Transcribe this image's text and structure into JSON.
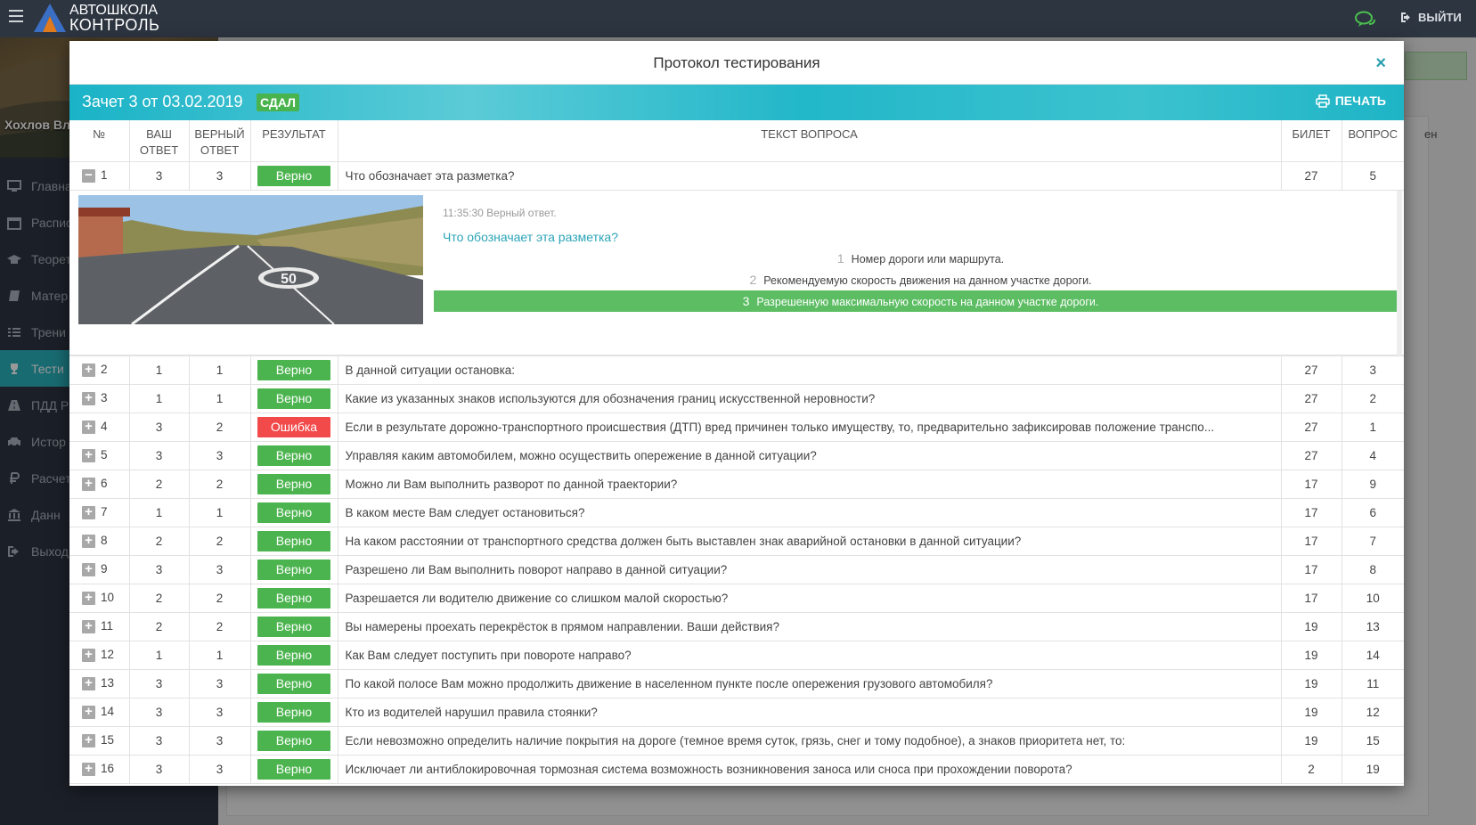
{
  "topbar": {
    "logo_line1": "АВТОШКОЛА",
    "logo_line2": "КОНТРОЛЬ",
    "logout_label": "ВЫЙТИ",
    "icons": [
      "menu-icon",
      "chat-icon",
      "logout-icon"
    ]
  },
  "sidebar": {
    "user_name": "Хохлов Вл",
    "items": [
      {
        "label": "Главна",
        "icon": "monitor-icon"
      },
      {
        "label": "Распис",
        "icon": "calendar-icon"
      },
      {
        "label": "Теорет",
        "icon": "graduation-cap-icon"
      },
      {
        "label": "Матер",
        "icon": "book-icon"
      },
      {
        "label": "Трени",
        "icon": "list-icon"
      },
      {
        "label": "Тести",
        "icon": "trophy-icon",
        "active": true
      },
      {
        "label": "ПДД Р",
        "icon": "road-icon"
      },
      {
        "label": "Истор",
        "icon": "car-icon"
      },
      {
        "label": "Расчет",
        "icon": "ruble-icon"
      },
      {
        "label": "Данн",
        "icon": "bank-icon"
      },
      {
        "label": "Выход",
        "icon": "sign-out-icon"
      }
    ]
  },
  "background": {
    "side_text": "ен"
  },
  "modal": {
    "title": "Протокол тестирования",
    "close_symbol": "×",
    "exam_title": "Зачет 3 от 03.02.2019",
    "status_badge": "СДАЛ",
    "print_label": "ПЕЧАТЬ",
    "columns": {
      "num": "№",
      "your_1": "ВАШ",
      "your_2": "ОТВЕТ",
      "correct_1": "ВЕРНЫЙ",
      "correct_2": "ОТВЕТ",
      "result": "РЕЗУЛЬТАТ",
      "text": "ТЕКСТ ВОПРОСА",
      "ticket": "БИЛЕТ",
      "question": "ВОПРОС"
    },
    "expanded": {
      "time_note": "11:35:30 Верный ответ.",
      "question": "Что обозначает эта разметка?",
      "image_speed_mark": "50",
      "selected_index": 3,
      "options": [
        {
          "n": "1",
          "text": "Номер дороги или маршрута."
        },
        {
          "n": "2",
          "text": "Рекомендуемую скорость движения на данном участке дороги."
        },
        {
          "n": "3",
          "text": "Разрешенную максимальную скорость на данном участке дороги."
        }
      ]
    },
    "rows": [
      {
        "num": "1",
        "toggle": "−",
        "your": "3",
        "correct": "3",
        "result": "Верно",
        "ok": true,
        "text": "Что обозначает эта разметка?",
        "ticket": "27",
        "question": "5"
      },
      {
        "num": "2",
        "toggle": "+",
        "your": "1",
        "correct": "1",
        "result": "Верно",
        "ok": true,
        "text": "В данной ситуации остановка:",
        "ticket": "27",
        "question": "3"
      },
      {
        "num": "3",
        "toggle": "+",
        "your": "1",
        "correct": "1",
        "result": "Верно",
        "ok": true,
        "text": "Какие из указанных знаков используются для обозначения границ искусственной неровности?",
        "ticket": "27",
        "question": "2"
      },
      {
        "num": "4",
        "toggle": "+",
        "your": "3",
        "correct": "2",
        "result": "Ошибка",
        "ok": false,
        "text": "Если в результате дорожно-транспортного происшествия (ДТП) вред причинен только имуществу, то, предварительно зафиксировав положение транспо...",
        "ticket": "27",
        "question": "1"
      },
      {
        "num": "5",
        "toggle": "+",
        "your": "3",
        "correct": "3",
        "result": "Верно",
        "ok": true,
        "text": "Управляя каким автомобилем, можно осуществить опережение в данной ситуации?",
        "ticket": "27",
        "question": "4"
      },
      {
        "num": "6",
        "toggle": "+",
        "your": "2",
        "correct": "2",
        "result": "Верно",
        "ok": true,
        "text": "Можно ли Вам выполнить разворот по данной траектории?",
        "ticket": "17",
        "question": "9"
      },
      {
        "num": "7",
        "toggle": "+",
        "your": "1",
        "correct": "1",
        "result": "Верно",
        "ok": true,
        "text": "В каком месте Вам следует остановиться?",
        "ticket": "17",
        "question": "6"
      },
      {
        "num": "8",
        "toggle": "+",
        "your": "2",
        "correct": "2",
        "result": "Верно",
        "ok": true,
        "text": "На каком расстоянии от транспортного средства должен быть выставлен знак аварийной остановки в данной ситуации?",
        "ticket": "17",
        "question": "7"
      },
      {
        "num": "9",
        "toggle": "+",
        "your": "3",
        "correct": "3",
        "result": "Верно",
        "ok": true,
        "text": "Разрешено ли Вам выполнить поворот направо в данной ситуации?",
        "ticket": "17",
        "question": "8"
      },
      {
        "num": "10",
        "toggle": "+",
        "your": "2",
        "correct": "2",
        "result": "Верно",
        "ok": true,
        "text": "Разрешается ли водителю движение со слишком малой скоростью?",
        "ticket": "17",
        "question": "10"
      },
      {
        "num": "11",
        "toggle": "+",
        "your": "2",
        "correct": "2",
        "result": "Верно",
        "ok": true,
        "text": "Вы намерены проехать перекрёсток в прямом направлении. Ваши действия?",
        "ticket": "19",
        "question": "13"
      },
      {
        "num": "12",
        "toggle": "+",
        "your": "1",
        "correct": "1",
        "result": "Верно",
        "ok": true,
        "text": "Как Вам следует поступить при повороте направо?",
        "ticket": "19",
        "question": "14"
      },
      {
        "num": "13",
        "toggle": "+",
        "your": "3",
        "correct": "3",
        "result": "Верно",
        "ok": true,
        "text": "По какой полосе Вам можно продолжить движение в населенном пункте после опережения грузового автомобиля?",
        "ticket": "19",
        "question": "11"
      },
      {
        "num": "14",
        "toggle": "+",
        "your": "3",
        "correct": "3",
        "result": "Верно",
        "ok": true,
        "text": "Кто из водителей нарушил правила стоянки?",
        "ticket": "19",
        "question": "12"
      },
      {
        "num": "15",
        "toggle": "+",
        "your": "3",
        "correct": "3",
        "result": "Верно",
        "ok": true,
        "text": "Если невозможно определить наличие покрытия на дороге (темное время суток, грязь, снег и тому подобное), а знаков приоритета нет, то:",
        "ticket": "19",
        "question": "15"
      },
      {
        "num": "16",
        "toggle": "+",
        "your": "3",
        "correct": "3",
        "result": "Верно",
        "ok": true,
        "text": "Исключает ли антиблокировочная тормозная система возможность возникновения заноса или сноса при прохождении поворота?",
        "ticket": "2",
        "question": "19"
      }
    ]
  }
}
